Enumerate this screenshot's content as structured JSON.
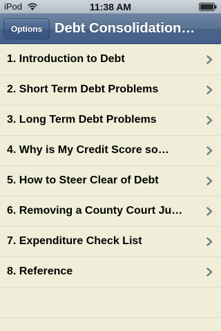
{
  "statusbar": {
    "carrier": "iPod",
    "time": "11:38 AM"
  },
  "navbar": {
    "options_label": "Options",
    "title": "Debt Consolidation…"
  },
  "items": [
    {
      "label": "1. Introduction to Debt"
    },
    {
      "label": "2. Short Term Debt Problems"
    },
    {
      "label": "3. Long Term Debt Problems"
    },
    {
      "label": "4. Why is My Credit Score so…"
    },
    {
      "label": "5. How to Steer Clear of Debt"
    },
    {
      "label": "6. Removing a County Court Ju…"
    },
    {
      "label": "7. Expenditure Check List"
    },
    {
      "label": "8. Reference"
    }
  ],
  "colors": {
    "background": "#efefd9",
    "navbar": "#4a6388",
    "text": "#000000",
    "chevron": "#7f7f7f"
  },
  "icons": [
    "wifi-icon",
    "battery-icon",
    "chevron-right-icon"
  ]
}
